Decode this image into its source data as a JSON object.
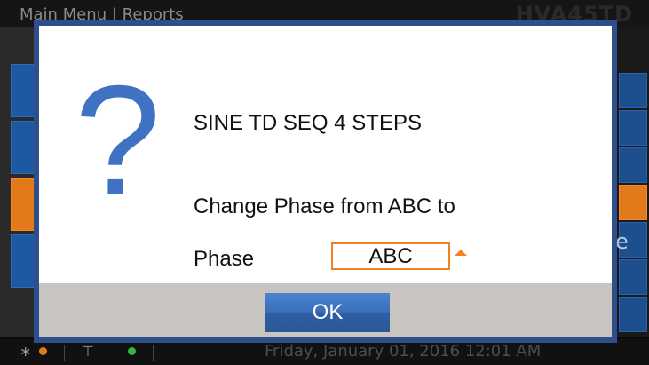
{
  "window": {
    "breadcrumb": "Main Menu | Reports",
    "model": "HVA45TD"
  },
  "statusbar": {
    "clock": "Friday, January 01, 2016 12:01 AM",
    "bluetooth_icon": "bluetooth-icon",
    "usb_icon": "usb-icon",
    "status_colors": {
      "left": "#e27a1c",
      "right": "#37b34a"
    }
  },
  "background_right": {
    "partial_glyph": "e"
  },
  "dialog": {
    "icon": "question-mark-icon",
    "title": "SINE TD SEQ 4 STEPS",
    "message": "Change Phase from ABC to",
    "phase_label": "Phase",
    "phase_value": "ABC",
    "ok_label": "OK",
    "accent_color": "#f0831f",
    "border_color": "#2e4f8c"
  }
}
